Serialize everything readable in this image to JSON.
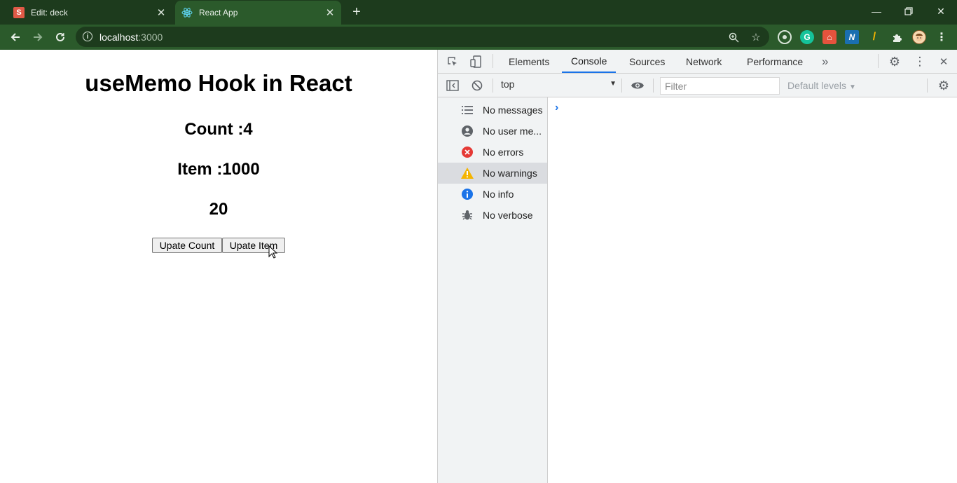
{
  "browser": {
    "tabs": [
      {
        "title": "Edit: deck",
        "favicon": "S",
        "active": false
      },
      {
        "title": "React App",
        "favicon": "react-icon",
        "active": true
      }
    ],
    "url_host": "localhost",
    "url_port": ":3000"
  },
  "page": {
    "heading": "useMemo Hook in React",
    "count_text": "Count :4",
    "item_text": "Item :1000",
    "memo_value": "20",
    "buttons": {
      "update_count": "Upate Count",
      "update_item": "Upate Item"
    }
  },
  "devtools": {
    "tabs": [
      "Elements",
      "Console",
      "Sources",
      "Network",
      "Performance"
    ],
    "active_tab": "Console",
    "more_tabs": "»",
    "context": "top",
    "filter_placeholder": "Filter",
    "levels": "Default levels",
    "sidebar": [
      {
        "label": "No messages",
        "icon": "list-icon"
      },
      {
        "label": "No user me...",
        "icon": "user-icon"
      },
      {
        "label": "No errors",
        "icon": "error-icon"
      },
      {
        "label": "No warnings",
        "icon": "warning-icon",
        "selected": true
      },
      {
        "label": "No info",
        "icon": "info-icon"
      },
      {
        "label": "No verbose",
        "icon": "bug-icon"
      }
    ],
    "prompt": "›"
  },
  "colors": {
    "titlebar": "#1d3b1d",
    "toolbar": "#2b5a2b",
    "accent": "#1a73e8",
    "error": "#e53935",
    "warning": "#f4b400",
    "info": "#1a73e8"
  }
}
